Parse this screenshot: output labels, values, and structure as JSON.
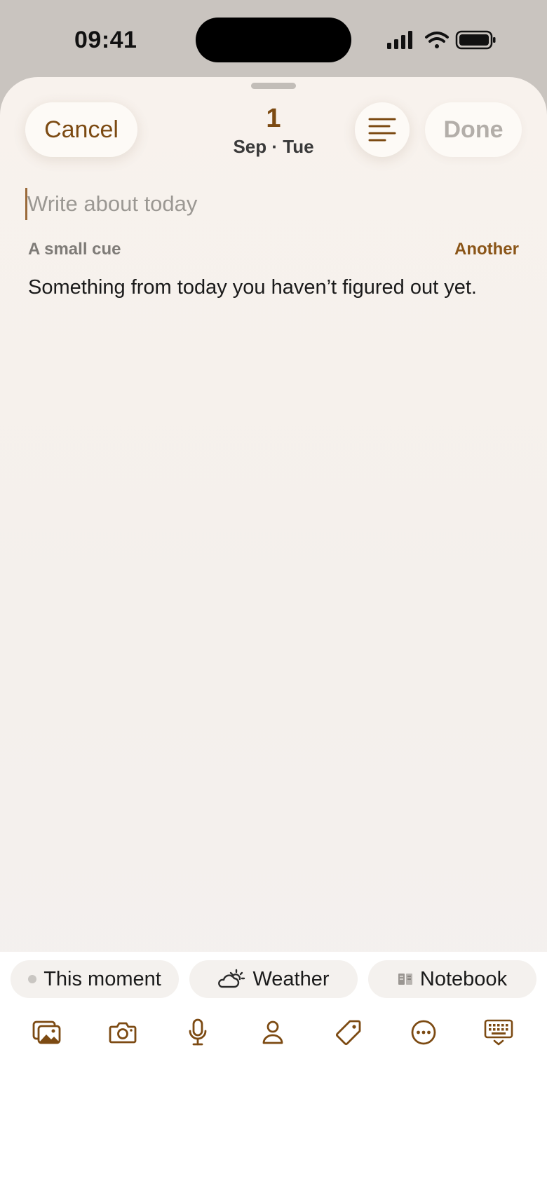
{
  "status": {
    "time": "09:41"
  },
  "header": {
    "cancel_label": "Cancel",
    "done_label": "Done",
    "day": "1",
    "month_weekday": "Sep · Tue"
  },
  "editor": {
    "placeholder": "Write about today"
  },
  "cue": {
    "label": "A small cue",
    "another_label": "Another",
    "text": "Something from today you haven’t figured out yet."
  },
  "chips": [
    {
      "label": "This moment",
      "icon": "dot-icon"
    },
    {
      "label": "Weather",
      "icon": "cloud-sun-icon"
    },
    {
      "label": "Notebook",
      "icon": "notebook-icon"
    }
  ],
  "toolbar": [
    {
      "icon": "photo-library-icon"
    },
    {
      "icon": "camera-icon"
    },
    {
      "icon": "microphone-icon"
    },
    {
      "icon": "person-icon"
    },
    {
      "icon": "tag-icon"
    },
    {
      "icon": "more-icon"
    },
    {
      "icon": "keyboard-dismiss-icon"
    }
  ],
  "colors": {
    "accent": "#7c4a12",
    "sheet_background": "#f6f1ec",
    "muted_text": "#9b9893"
  }
}
